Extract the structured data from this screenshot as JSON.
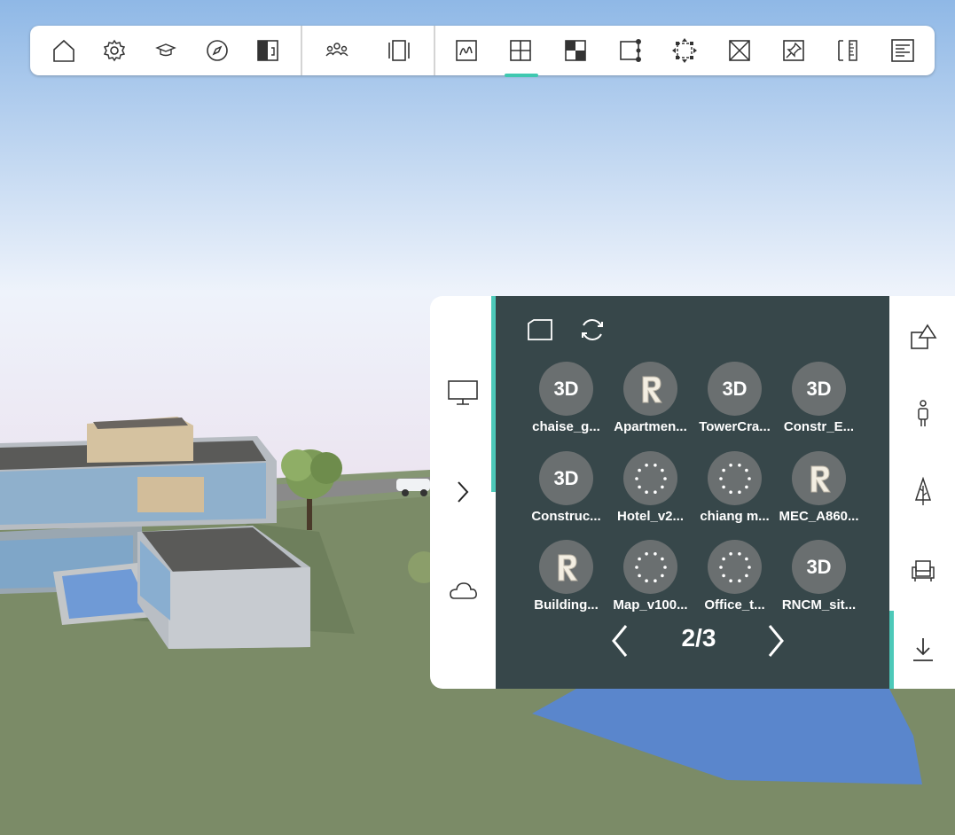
{
  "toolbar": {
    "items": [
      {
        "icon": "home-icon"
      },
      {
        "icon": "gear-icon"
      },
      {
        "icon": "graduation-cap-icon"
      },
      {
        "icon": "compass-icon"
      },
      {
        "icon": "split-view-icon"
      },
      {
        "icon": "people-icon"
      },
      {
        "icon": "frame-icon"
      },
      {
        "icon": "sketch-icon"
      },
      {
        "icon": "section-plane-icon"
      },
      {
        "icon": "checker-icon"
      },
      {
        "icon": "node-edit-icon"
      },
      {
        "icon": "transform-icon"
      },
      {
        "icon": "cross-box-icon"
      },
      {
        "icon": "pin-icon"
      },
      {
        "icon": "measure-icon"
      },
      {
        "icon": "list-icon"
      }
    ],
    "active_item": "section-plane-icon",
    "accent_color": "#3fc8b0"
  },
  "left_strip": {
    "items": [
      {
        "icon": "monitor-icon"
      },
      {
        "icon": "chevron-right-icon"
      },
      {
        "icon": "cloud-icon"
      }
    ]
  },
  "panel": {
    "top_buttons": [
      {
        "icon": "folder-icon"
      },
      {
        "icon": "refresh-icon"
      }
    ],
    "files": [
      {
        "label": "chaise_g...",
        "type": "3D"
      },
      {
        "label": "Apartmen...",
        "type": "R"
      },
      {
        "label": "TowerCra...",
        "type": "3D"
      },
      {
        "label": "Constr_E...",
        "type": "3D"
      },
      {
        "label": "Construc...",
        "type": "3D"
      },
      {
        "label": "Hotel_v2...",
        "type": "loading"
      },
      {
        "label": "chiang m...",
        "type": "loading"
      },
      {
        "label": "MEC_A860...",
        "type": "R"
      },
      {
        "label": "Building...",
        "type": "R"
      },
      {
        "label": "Map_v100...",
        "type": "loading"
      },
      {
        "label": "Office_t...",
        "type": "loading"
      },
      {
        "label": "RNCM_sit...",
        "type": "3D"
      }
    ],
    "pagination": {
      "text": "2/3",
      "current": 2,
      "total": 3
    },
    "background_color": "#37474a"
  },
  "right_strip": {
    "items": [
      {
        "icon": "shapes-icon"
      },
      {
        "icon": "person-icon"
      },
      {
        "icon": "tree-icon"
      },
      {
        "icon": "armchair-icon"
      },
      {
        "icon": "download-icon"
      }
    ]
  }
}
